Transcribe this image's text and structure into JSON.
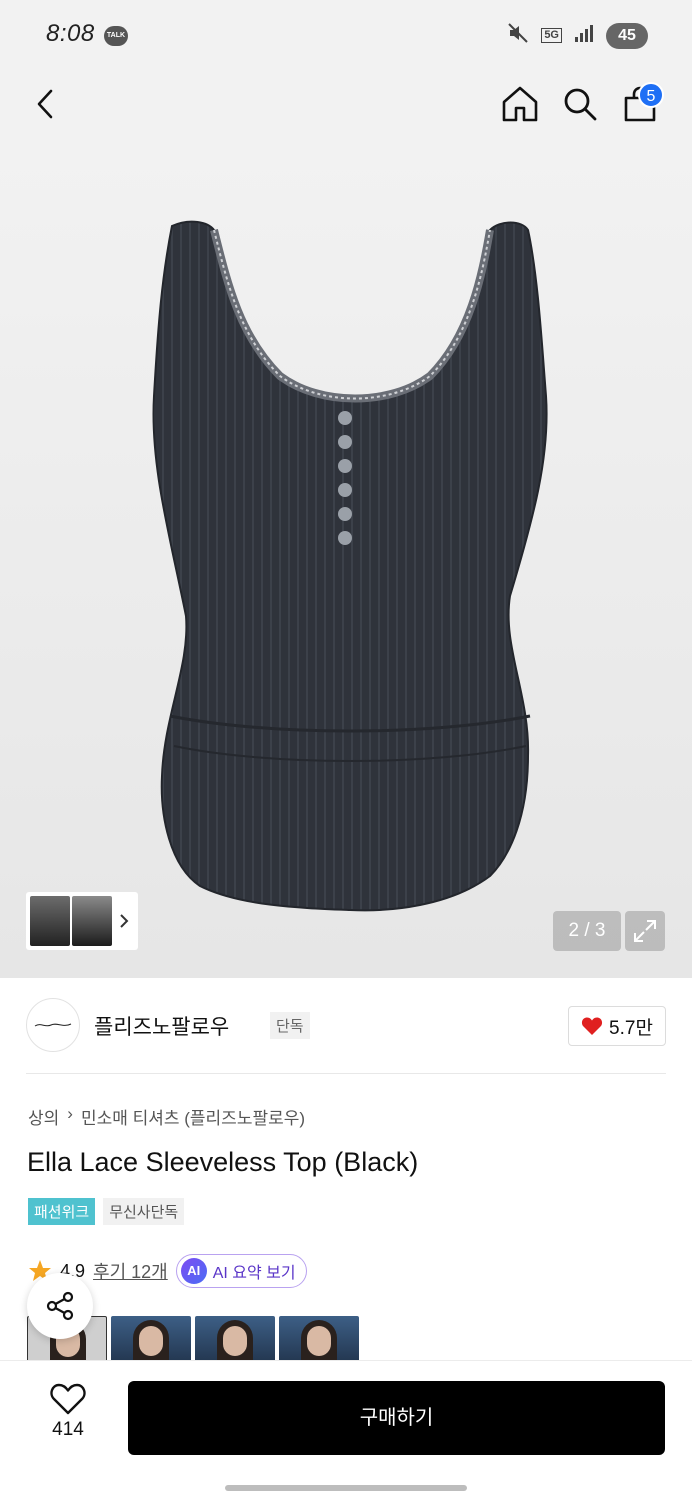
{
  "status_bar": {
    "time": "8:08",
    "talk_badge": "TALK",
    "network_label": "5G",
    "battery": "45"
  },
  "nav": {
    "cart_count": "5",
    "accent_color": "#1e6ff5"
  },
  "gallery": {
    "page_indicator": "2 / 3"
  },
  "brand": {
    "name": "플리즈노팔로우",
    "exclusive_tag": "단독",
    "likes": "5.7만"
  },
  "product": {
    "breadcrumb": [
      "상의",
      "민소매 티셔츠 (플리즈노팔로우)"
    ],
    "title": "Ella Lace Sleeveless Top (Black)",
    "tags": [
      "패션위크",
      "무신사단독"
    ],
    "rating": "4.9",
    "review_link": "후기 12개",
    "ai_badge": "AI",
    "ai_summary_label": "AI 요약 보기"
  },
  "bottom": {
    "wish_count": "414",
    "buy_label": "구매하기"
  }
}
